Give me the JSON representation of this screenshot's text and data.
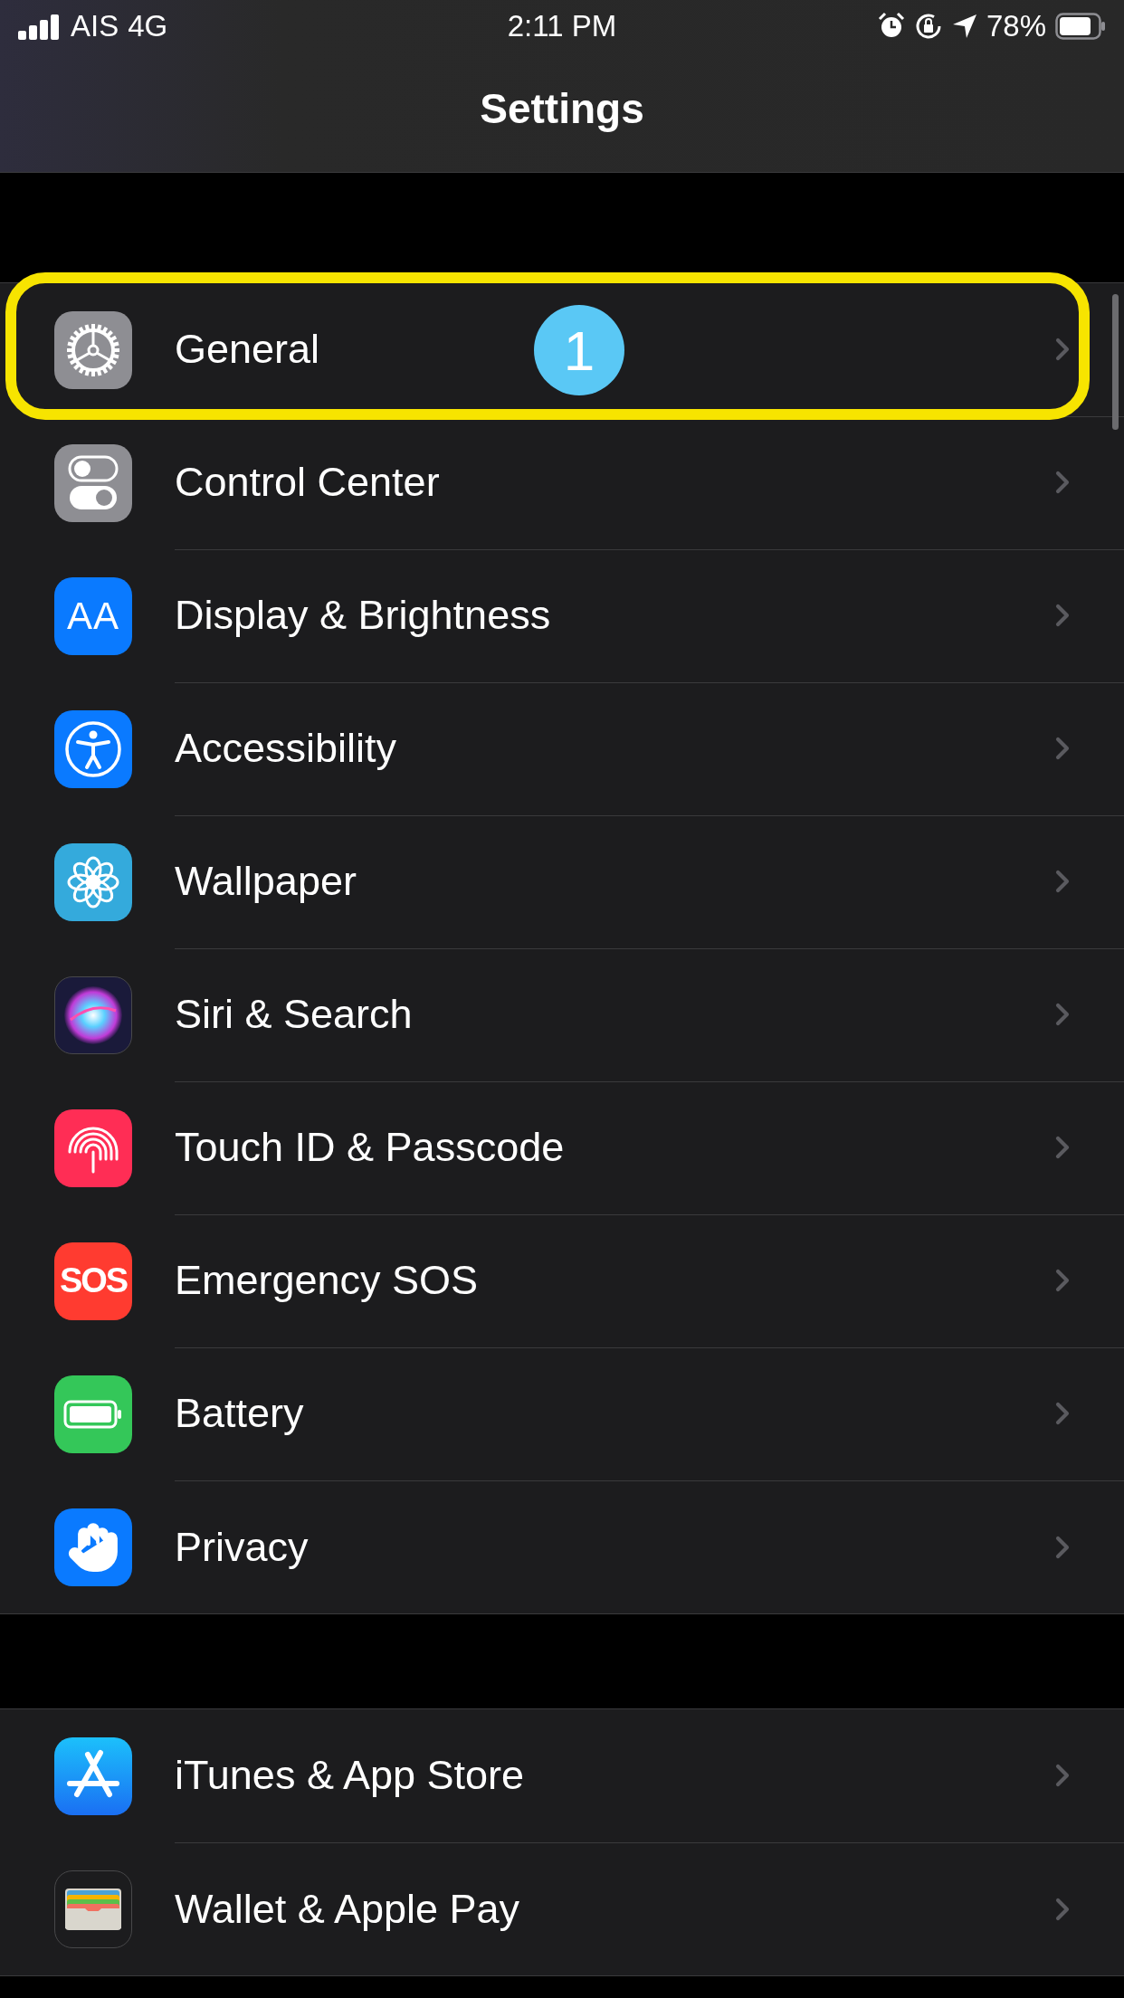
{
  "status_bar": {
    "carrier": "AIS",
    "network": "4G",
    "time": "2:11 PM",
    "battery": "78%"
  },
  "nav": {
    "title": "Settings"
  },
  "groups": [
    {
      "rows": [
        {
          "kind": "gear",
          "label": "General",
          "highlighted": true,
          "badge": "1"
        },
        {
          "kind": "toggles",
          "label": "Control Center",
          "highlighted": false
        },
        {
          "kind": "text",
          "icon_text": "AA",
          "label": "Display & Brightness",
          "highlighted": false
        },
        {
          "kind": "accessibility",
          "label": "Accessibility",
          "highlighted": false
        },
        {
          "kind": "flower",
          "label": "Wallpaper",
          "highlighted": false
        },
        {
          "kind": "siri",
          "label": "Siri & Search",
          "highlighted": false
        },
        {
          "kind": "fingerprint",
          "label": "Touch ID & Passcode",
          "highlighted": false
        },
        {
          "kind": "sos",
          "icon_text": "SOS",
          "label": "Emergency SOS",
          "highlighted": false
        },
        {
          "kind": "battery",
          "label": "Battery",
          "highlighted": false
        },
        {
          "kind": "hand",
          "label": "Privacy",
          "highlighted": false
        }
      ]
    },
    {
      "rows": [
        {
          "kind": "appstore",
          "label": "iTunes & App Store",
          "highlighted": false
        },
        {
          "kind": "wallet",
          "label": "Wallet & Apple Pay",
          "highlighted": false
        }
      ]
    }
  ]
}
